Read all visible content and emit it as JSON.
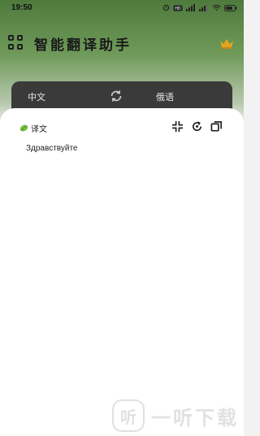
{
  "status_bar": {
    "time": "19:50",
    "icons": [
      "alarm-icon",
      "hd-icon",
      "signal-5g-icon",
      "signal-4g-icon",
      "wifi-icon",
      "battery-icon"
    ]
  },
  "header": {
    "title": "智能翻译助手",
    "menu_icon": "grid-icon",
    "vip_icon": "crown-icon"
  },
  "language_bar": {
    "source": "中文",
    "target": "俄语",
    "swap_icon": "swap-icon"
  },
  "result": {
    "label": "译文",
    "text": "Здравствуйте",
    "tools": [
      "collapse-icon",
      "refresh-icon",
      "copy-icon"
    ]
  },
  "watermark": {
    "logo": "听",
    "text": "一听下载"
  },
  "colors": {
    "accent_green": "#4e7a3c",
    "language_bar_bg": "#3a3a3a",
    "card_bg": "#ffffff"
  }
}
